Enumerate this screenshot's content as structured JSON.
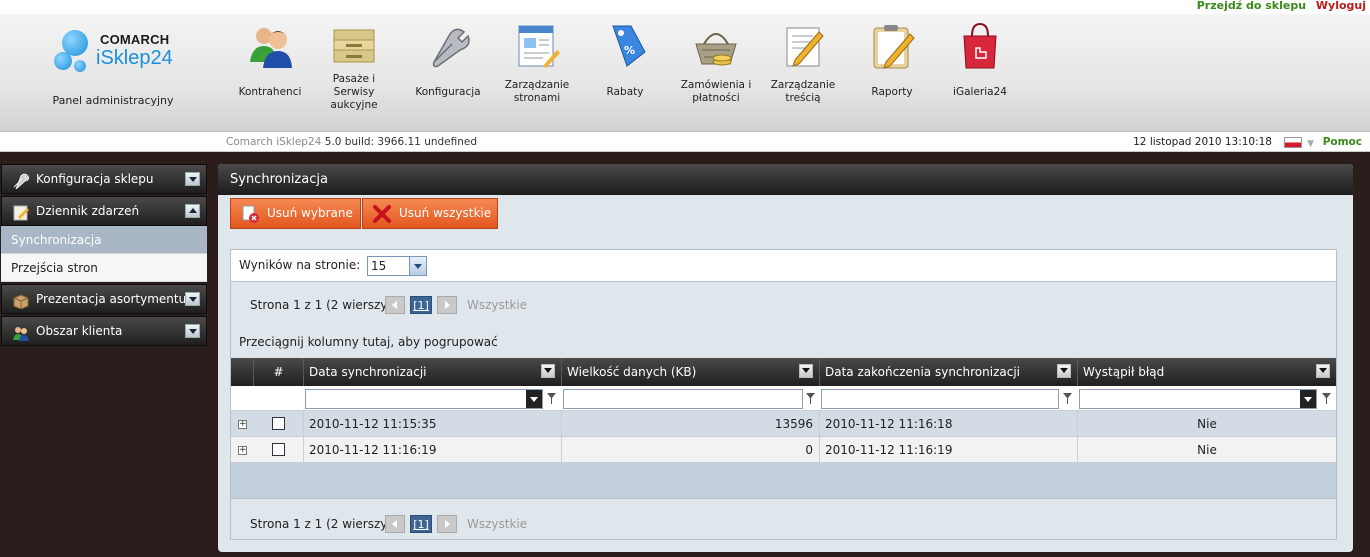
{
  "toplinks": {
    "goto_shop": "Przejdź do sklepu",
    "logout": "Wyloguj"
  },
  "logo": {
    "brand": "COMARCH",
    "product": "iSklep24"
  },
  "panel_label": "Panel administracyjny",
  "nav": [
    {
      "label": "Kontrahenci",
      "icon": "contractors-icon"
    },
    {
      "label": "Pasaże i Serwisy aukcyjne",
      "icon": "auction-folder-icon"
    },
    {
      "label": "Konfiguracja",
      "icon": "wrench-icon"
    },
    {
      "label": "Zarządzanie stronami",
      "icon": "pages-icon"
    },
    {
      "label": "Rabaty",
      "icon": "discount-tag-icon"
    },
    {
      "label": "Zamówienia i płatności",
      "icon": "basket-coins-icon"
    },
    {
      "label": "Zarządzanie treścią",
      "icon": "content-edit-icon"
    },
    {
      "label": "Raporty",
      "icon": "report-clipboard-icon"
    },
    {
      "label": "iGaleria24",
      "icon": "shopping-bag-icon"
    }
  ],
  "statusbar": {
    "app": "Comarch iSklep24",
    "build": "5.0 build: 3966.11",
    "extra": "undefined",
    "datetime": "12 listopad 2010 13:10:18",
    "help": "Pomoc"
  },
  "sidebar": {
    "sections": [
      {
        "label": "Konfiguracja sklepu",
        "icon": "wrench-icon"
      },
      {
        "label": "Dziennik zdarzeń",
        "icon": "journal-icon"
      },
      {
        "label": "Prezentacja asortymentu",
        "icon": "box-icon"
      },
      {
        "label": "Obszar klienta",
        "icon": "users-icon"
      }
    ],
    "journal_items": [
      "Synchronizacja",
      "Przejścia stron"
    ]
  },
  "main": {
    "title": "Synchronizacja",
    "buttons": {
      "delete_selected": "Usuń wybrane",
      "delete_all": "Usuń wszystkie"
    },
    "results_label": "Wyników na stronie:",
    "results_value": "15",
    "pager": {
      "text": "Strona 1 z 1 (2 wierszy)",
      "current": "[1]",
      "all": "Wszystkie"
    },
    "group_hint": "Przeciągnij kolumny tutaj, aby pogrupować",
    "columns": [
      "#",
      "Data synchronizacji",
      "Wielkość danych (KB)",
      "Data zakończenia synchronizacji",
      "Wystąpił błąd"
    ],
    "rows": [
      {
        "sync_date": "2010-11-12 11:15:35",
        "size_kb": "13596",
        "end_date": "2010-11-12 11:16:18",
        "error": "Nie"
      },
      {
        "sync_date": "2010-11-12 11:16:19",
        "size_kb": "0",
        "end_date": "2010-11-12 11:16:19",
        "error": "Nie"
      }
    ],
    "expand_symbol": "+"
  }
}
